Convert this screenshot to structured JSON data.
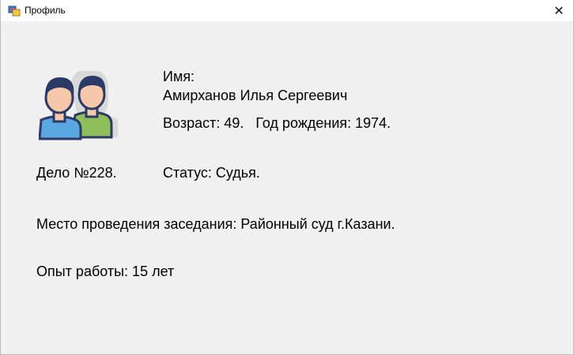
{
  "window": {
    "title": "Профиль",
    "app_icon": "form-icon",
    "close_glyph": "✕"
  },
  "avatar": {
    "icon": "users-icon"
  },
  "profile": {
    "name_label": "Имя:",
    "name": "Амирханов Илья Сергеевич",
    "age_birth": "Возраст: 49.   Год рождения: 1974.",
    "case": "Дело №228.",
    "status": "Статус: Судья.",
    "venue": "Место проведения заседания: Районный суд г.Казани.",
    "experience": "Опыт работы: 15 лет"
  }
}
